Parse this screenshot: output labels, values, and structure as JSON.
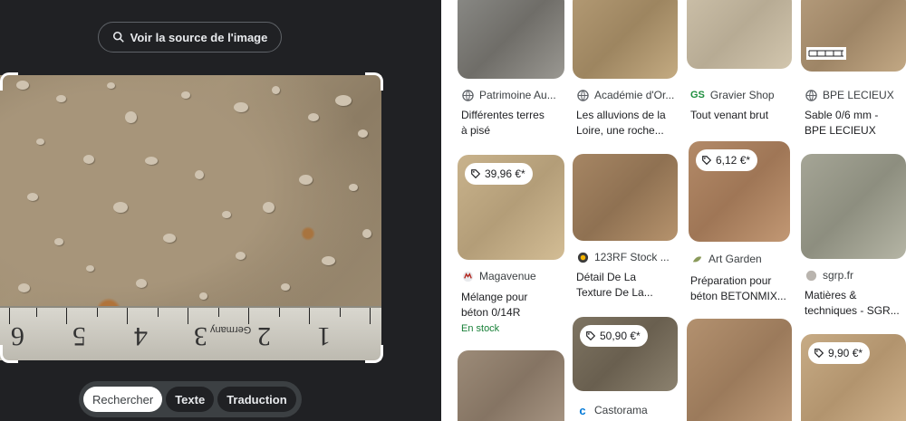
{
  "source_button": {
    "label": "Voir la source de l'image",
    "icon": "lens-search-icon"
  },
  "ruler": {
    "numbers": [
      "6",
      "5",
      "4",
      "3",
      "2",
      "1"
    ],
    "brand": "Germany"
  },
  "modes": [
    {
      "label": "Rechercher",
      "active": true
    },
    {
      "label": "Texte",
      "active": false
    },
    {
      "label": "Traduction",
      "active": false
    }
  ],
  "results": [
    {
      "site": "Patrimoine Au...",
      "fav": "globe-icon",
      "title": "Différentes terres\nà pisé"
    },
    {
      "site": "Académie d'Or...",
      "fav": "globe-icon",
      "title": "Les alluvions de la\nLoire, une roche..."
    },
    {
      "site": "Gravier Shop",
      "fav": "GS",
      "title": "Tout venant brut"
    },
    {
      "site": "BPE LECIEUX",
      "fav": "globe-icon",
      "title": "Sable 0/6 mm -\nBPE LECIEUX"
    },
    {
      "price": "39,96 €*",
      "site": "Magavenue",
      "title": "Mélange pour\nbéton 0/14R",
      "stock": "En stock"
    },
    {
      "site": "123RF Stock ...",
      "title": "Détail De La\nTexture De La..."
    },
    {
      "price": "6,12 €*",
      "site": "Art Garden",
      "title": "Préparation pour\nbéton BETONMIX..."
    },
    {
      "site": "sgrp.fr",
      "title": "Matières &\ntechniques - SGR..."
    },
    {
      "price": "50,90 €*",
      "site": "Castorama"
    },
    {
      "price": "9,90 €*"
    }
  ],
  "colors": {
    "dark_bg": "#202124",
    "mode_bar": "#3c4043",
    "stock_green": "#188038",
    "gravier_green": "#1e8e3e"
  }
}
